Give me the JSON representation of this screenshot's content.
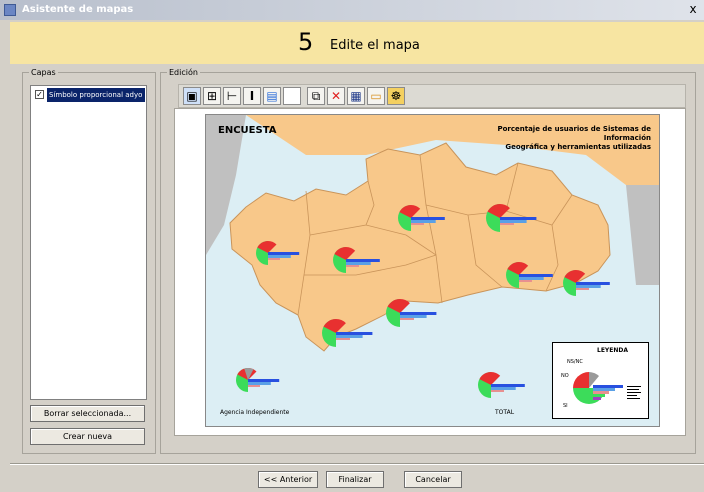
{
  "window": {
    "title": "Asistente de mapas",
    "close_glyph": "x"
  },
  "step": {
    "number": "5",
    "title": "Edite el mapa"
  },
  "layers_panel": {
    "legend": "Capas",
    "items": [
      {
        "label": "Símbolo proporcional adyo",
        "checked": true
      }
    ],
    "delete_button": "Borrar seleccionada...",
    "new_button": "Crear nueva"
  },
  "edit_panel": {
    "legend": "Edición",
    "tools": [
      {
        "name": "select-tool-icon",
        "glyph": "▣"
      },
      {
        "name": "grid-tool-icon",
        "glyph": "⊞"
      },
      {
        "name": "horizontal-align-icon",
        "glyph": "⊢"
      },
      {
        "name": "text-tool-icon",
        "glyph": "I"
      },
      {
        "name": "image-tool-icon",
        "glyph": "▤"
      },
      {
        "name": "blank-tool-icon",
        "glyph": ""
      },
      {
        "name": "copy-icon",
        "glyph": "⧉"
      },
      {
        "name": "delete-icon",
        "glyph": "✕"
      },
      {
        "name": "save-icon",
        "glyph": "▦"
      },
      {
        "name": "open-folder-icon",
        "glyph": "▭"
      },
      {
        "name": "settings-icon",
        "glyph": "☸"
      }
    ]
  },
  "map": {
    "title": "ENCUESTA",
    "subtitle_line1": "Porcentaje de usuarios de Sistemas de Información",
    "subtitle_line2": "Geográfica y herramientas utilizadas",
    "label_independent": "Agencia Independiente",
    "label_total": "TOTAL",
    "legend_title": "LEYENDA",
    "legend_ns": "NS/NC",
    "legend_no": "NO",
    "legend_si": "SI",
    "colors": {
      "si": "#3cdc5a",
      "no": "#e83030",
      "nsnc": "#9a9a9a",
      "bar1": "#2850e0",
      "bar2": "#5aa0e6",
      "bar3": "#e89090",
      "land": "#f8c88a",
      "sea": "#dceef4",
      "outside": "#c0c0c0"
    }
  },
  "footer": {
    "back": "<< Anterior",
    "finish": "Finalizar",
    "cancel": "Cancelar"
  }
}
